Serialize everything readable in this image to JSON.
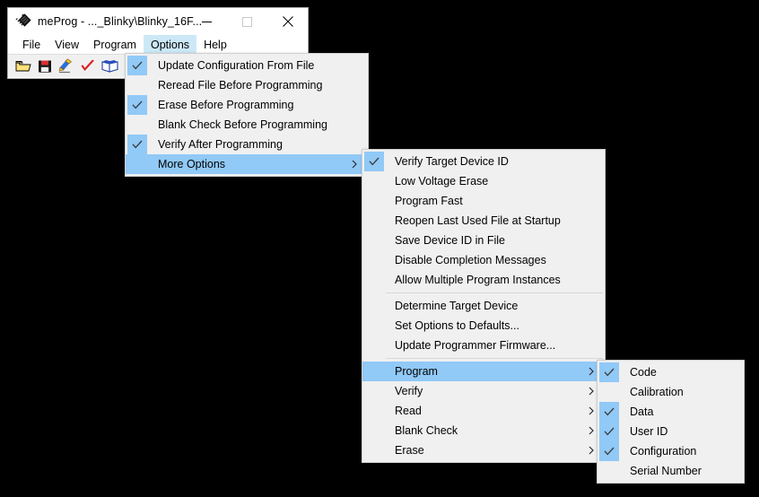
{
  "window": {
    "title": "meProg - ..._Blinky\\Blinky_16F...",
    "icon": "chip-icon",
    "controls": {
      "minimize": "minimize-icon",
      "maximize": "maximize-icon",
      "close": "close-icon"
    }
  },
  "menu_bar": {
    "items": [
      {
        "label": "File",
        "active": false
      },
      {
        "label": "View",
        "active": false
      },
      {
        "label": "Program",
        "active": false
      },
      {
        "label": "Options",
        "active": true
      },
      {
        "label": "Help",
        "active": false
      }
    ]
  },
  "toolbar": {
    "buttons": [
      {
        "name": "open-file-icon",
        "tip": "Open"
      },
      {
        "name": "save-file-icon",
        "tip": "Save"
      },
      {
        "name": "program-device-icon",
        "tip": "Program"
      },
      {
        "name": "verify-device-icon",
        "tip": "Verify"
      },
      {
        "name": "read-device-icon",
        "tip": "Read"
      },
      {
        "name": "blank-check-icon",
        "tip": "Blank Check"
      }
    ]
  },
  "menus": {
    "options": {
      "name": "options-menu",
      "items": [
        {
          "label": "Update Configuration From File",
          "checked": true,
          "selected": false,
          "submenu": false
        },
        {
          "label": "Reread File Before Programming",
          "checked": false,
          "selected": false,
          "submenu": false
        },
        {
          "label": "Erase Before Programming",
          "checked": true,
          "selected": false,
          "submenu": false
        },
        {
          "label": "Blank Check Before Programming",
          "checked": false,
          "selected": false,
          "submenu": false
        },
        {
          "label": "Verify After Programming",
          "checked": true,
          "selected": false,
          "submenu": false
        },
        {
          "label": "More Options",
          "checked": false,
          "selected": true,
          "submenu": true
        }
      ]
    },
    "more_options": {
      "name": "more-options-menu",
      "items": [
        {
          "label": "Verify Target Device ID",
          "checked": true,
          "selected": false,
          "submenu": false
        },
        {
          "label": "Low Voltage Erase",
          "checked": false,
          "selected": false,
          "submenu": false
        },
        {
          "label": "Program Fast",
          "checked": false,
          "selected": false,
          "submenu": false
        },
        {
          "label": "Reopen Last Used File at Startup",
          "checked": false,
          "selected": false,
          "submenu": false
        },
        {
          "label": "Save Device ID in File",
          "checked": false,
          "selected": false,
          "submenu": false
        },
        {
          "label": "Disable Completion Messages",
          "checked": false,
          "selected": false,
          "submenu": false
        },
        {
          "label": "Allow Multiple Program Instances",
          "checked": false,
          "selected": false,
          "submenu": false
        },
        {
          "separator": true
        },
        {
          "label": "Determine Target Device",
          "checked": false,
          "selected": false,
          "submenu": false
        },
        {
          "label": "Set Options to Defaults...",
          "checked": false,
          "selected": false,
          "submenu": false
        },
        {
          "label": "Update Programmer Firmware...",
          "checked": false,
          "selected": false,
          "submenu": false
        },
        {
          "separator": true
        },
        {
          "label": "Program",
          "checked": false,
          "selected": true,
          "submenu": true
        },
        {
          "label": "Verify",
          "checked": false,
          "selected": false,
          "submenu": true
        },
        {
          "label": "Read",
          "checked": false,
          "selected": false,
          "submenu": true
        },
        {
          "label": "Blank Check",
          "checked": false,
          "selected": false,
          "submenu": true
        },
        {
          "label": "Erase",
          "checked": false,
          "selected": false,
          "submenu": true
        }
      ]
    },
    "program": {
      "name": "program-submenu",
      "items": [
        {
          "label": "Code",
          "checked": true,
          "selected": false,
          "submenu": false
        },
        {
          "label": "Calibration",
          "checked": false,
          "selected": false,
          "submenu": false
        },
        {
          "label": "Data",
          "checked": true,
          "selected": false,
          "submenu": false
        },
        {
          "label": "User ID",
          "checked": true,
          "selected": false,
          "submenu": false
        },
        {
          "label": "Configuration",
          "checked": true,
          "selected": false,
          "submenu": false
        },
        {
          "label": "Serial Number",
          "checked": false,
          "selected": false,
          "submenu": false
        }
      ]
    }
  },
  "colors": {
    "selection_blue": "#91c9f7",
    "menubar_highlight": "#cce8f7",
    "menu_background": "#f0f0f0",
    "window_background": "#ffffff",
    "desktop_background": "#000000"
  }
}
